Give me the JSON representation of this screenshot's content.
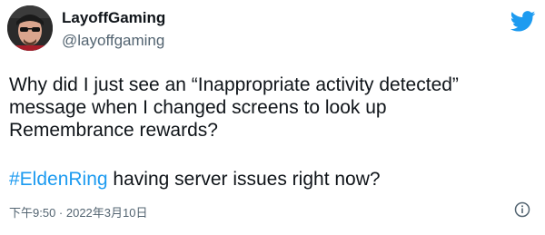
{
  "author": {
    "display_name": "LayoffGaming",
    "handle": "@layoffgaming"
  },
  "tweet": {
    "text_lines": [
      "Why did I just see an “Inappropriate activity detected”",
      "message when I changed screens to look up",
      "Remembrance rewards?"
    ],
    "hashtag": "#EldenRing",
    "hashtag_rest": " having server issues right now?",
    "timestamp": "下午9:50 · 2022年3月10日"
  },
  "icons": {
    "brand": "twitter-bird-icon",
    "info": "info-icon"
  },
  "colors": {
    "brand_blue": "#1d9bf0",
    "text": "#0f1419",
    "secondary": "#536471"
  }
}
